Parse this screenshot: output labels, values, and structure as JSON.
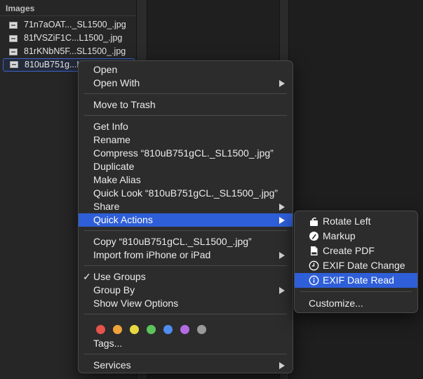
{
  "sidebar": {
    "header": "Images",
    "files": [
      {
        "name": "71n7aOAT..._SL1500_.jpg"
      },
      {
        "name": "81fVSZiF1C...L1500_.jpg"
      },
      {
        "name": "81rKNbN5F...SL1500_.jpg"
      },
      {
        "name": "810uB751g...L1500_.jpg"
      }
    ]
  },
  "menu": {
    "open": "Open",
    "open_with": "Open With",
    "move_to_trash": "Move to Trash",
    "get_info": "Get Info",
    "rename": "Rename",
    "compress": "Compress “810uB751gCL._SL1500_.jpg”",
    "duplicate": "Duplicate",
    "make_alias": "Make Alias",
    "quick_look": "Quick Look “810uB751gCL._SL1500_.jpg”",
    "share": "Share",
    "quick_actions": "Quick Actions",
    "copy": "Copy “810uB751gCL._SL1500_.jpg”",
    "import_from_iphone": "Import from iPhone or iPad",
    "use_groups_check": "✓",
    "use_groups": "Use Groups",
    "group_by": "Group By",
    "show_view_options": "Show View Options",
    "tags": "Tags...",
    "services": "Services",
    "tag_colors": [
      "#e5534b",
      "#f0a33a",
      "#e8d840",
      "#5cc45a",
      "#4f8ef0",
      "#b36ae2",
      "#9a9a9a"
    ]
  },
  "submenu": {
    "rotate_left": "Rotate Left",
    "markup": "Markup",
    "create_pdf": "Create PDF",
    "exif_date_change": "EXIF Date Change",
    "exif_date_read": "EXIF Date Read",
    "customize": "Customize..."
  },
  "colors": {
    "highlight": "#2f5fd8",
    "menu_bg": "#2c2c2c"
  }
}
